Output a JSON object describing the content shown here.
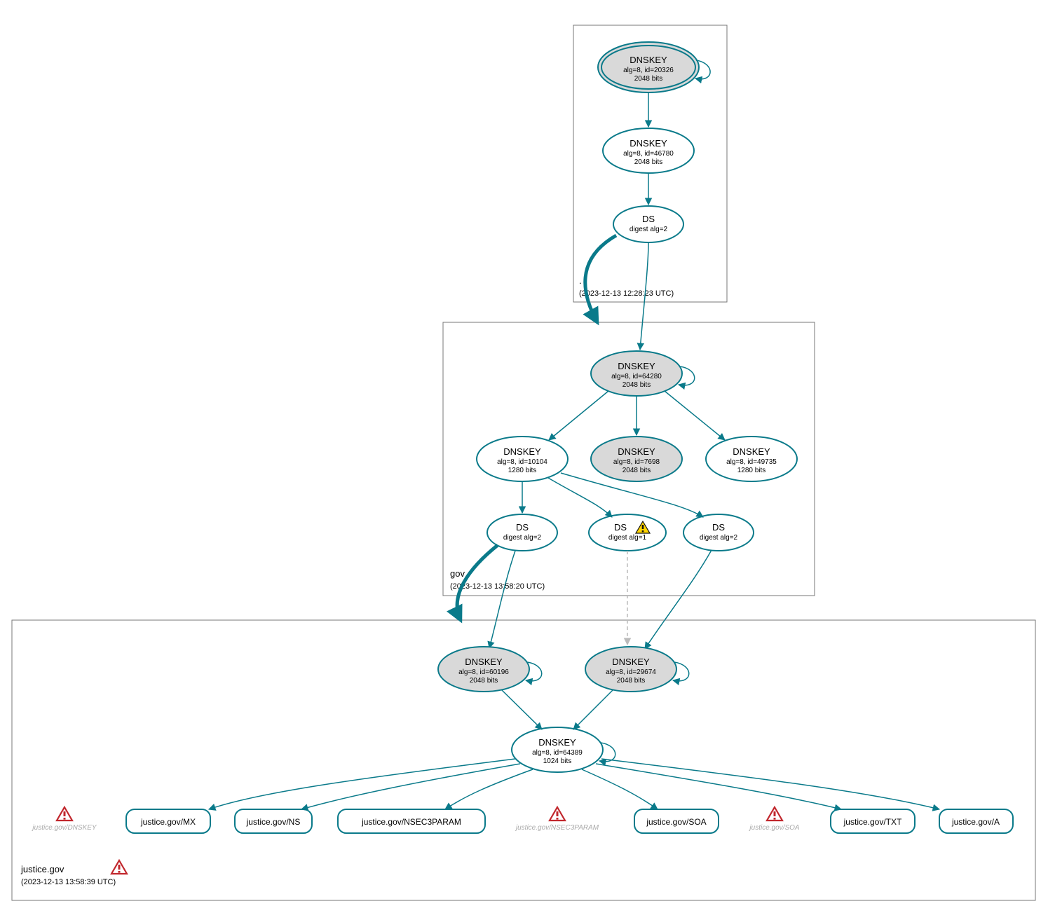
{
  "zones": {
    "root": {
      "label": ".",
      "timestamp": "(2023-12-13 12:28:23 UTC)",
      "nodes": {
        "k20326": {
          "title": "DNSKEY",
          "sub1": "alg=8, id=20326",
          "sub2": "2048 bits"
        },
        "k46780": {
          "title": "DNSKEY",
          "sub1": "alg=8, id=46780",
          "sub2": "2048 bits"
        },
        "ds2": {
          "title": "DS",
          "sub1": "digest alg=2"
        }
      }
    },
    "gov": {
      "label": "gov",
      "timestamp": "(2023-12-13 13:58:20 UTC)",
      "nodes": {
        "k64280": {
          "title": "DNSKEY",
          "sub1": "alg=8, id=64280",
          "sub2": "2048 bits"
        },
        "k10104": {
          "title": "DNSKEY",
          "sub1": "alg=8, id=10104",
          "sub2": "1280 bits"
        },
        "k7698": {
          "title": "DNSKEY",
          "sub1": "alg=8, id=7698",
          "sub2": "2048 bits"
        },
        "k49735": {
          "title": "DNSKEY",
          "sub1": "alg=8, id=49735",
          "sub2": "1280 bits"
        },
        "dsA": {
          "title": "DS",
          "sub1": "digest alg=2"
        },
        "dsB": {
          "title": "DS",
          "sub1": "digest alg=1"
        },
        "dsC": {
          "title": "DS",
          "sub1": "digest alg=2"
        }
      }
    },
    "justice": {
      "label": "justice.gov",
      "timestamp": "(2023-12-13 13:58:39 UTC)",
      "nodes": {
        "k60196": {
          "title": "DNSKEY",
          "sub1": "alg=8, id=60196",
          "sub2": "2048 bits"
        },
        "k29674": {
          "title": "DNSKEY",
          "sub1": "alg=8, id=29674",
          "sub2": "2048 bits"
        },
        "k64389": {
          "title": "DNSKEY",
          "sub1": "alg=8, id=64389",
          "sub2": "1024 bits"
        }
      },
      "rrsets": {
        "mx": "justice.gov/MX",
        "ns": "justice.gov/NS",
        "n3p": "justice.gov/NSEC3PARAM",
        "soa": "justice.gov/SOA",
        "txt": "justice.gov/TXT",
        "a": "justice.gov/A"
      },
      "ghosts": {
        "g_dnskey": "justice.gov/DNSKEY",
        "g_n3p": "justice.gov/NSEC3PARAM",
        "g_soa": "justice.gov/SOA"
      }
    }
  }
}
